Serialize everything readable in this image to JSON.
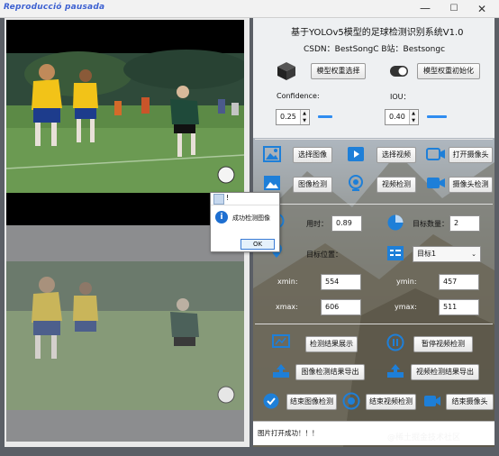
{
  "window": {
    "title": "Reproducció pausada",
    "min": "—",
    "max": "☐",
    "close": "✕"
  },
  "header": {
    "title": "基于YOLOv5模型的足球检测识别系统V1.0",
    "csdn": "CSDN：BestSongC   B站：Bestsongc"
  },
  "model": {
    "select_btn": "模型权重选择",
    "init_btn": "模型权重初始化"
  },
  "params": {
    "confidence_label": "Confidence:",
    "confidence_value": "0.25",
    "confidence_level": 0.25,
    "iou_label": "IOU：",
    "iou_value": "0.40",
    "iou_level": 0.4
  },
  "actions": {
    "select_image": "选择图像",
    "select_video": "选择视频",
    "open_camera": "打开摄像头",
    "image_detect": "图像检测",
    "video_detect": "视频检测",
    "camera_detect": "摄像头检测"
  },
  "result": {
    "time_label": "用时：",
    "time_value": "0.89",
    "count_label": "目标数量：",
    "count_value": "2",
    "pos_label": "目标位置：",
    "target_select": "目标1",
    "xmin_label": "xmin:",
    "xmin_value": "554",
    "ymin_label": "ymin:",
    "ymin_value": "457",
    "xmax_label": "xmax:",
    "xmax_value": "606",
    "ymax_label": "ymax:",
    "ymax_value": "511"
  },
  "controls": {
    "show_results": "检测结果展示",
    "pause_video": "暂停视频检测",
    "export_image": "图像检测结果导出",
    "export_video": "视频检测结果导出",
    "end_image": "结束图像检测",
    "end_video": "结束视频检测",
    "end_camera": "结束摄像头"
  },
  "dialog": {
    "title": "!",
    "message": "成功检测图像",
    "ok": "OK"
  },
  "status": {
    "text": "图片打开成功！！！"
  },
  "watermark": "@稀土掘金技术社区",
  "colors": {
    "title_blue": "#3b5fcf",
    "icon_blue": "#1e7fd8",
    "slider_blue": "#2f8cf0"
  }
}
